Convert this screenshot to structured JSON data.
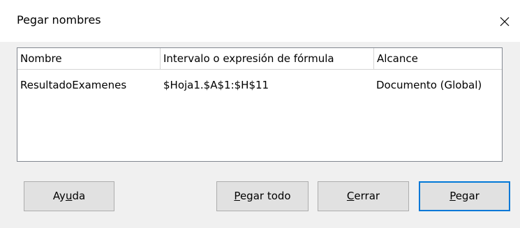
{
  "window": {
    "title": "Pegar nombres",
    "close_glyph": "close-icon"
  },
  "table": {
    "columns": [
      "Nombre",
      "Intervalo o expresión de fórmula",
      "Alcance"
    ],
    "rows": [
      {
        "name": "ResultadoExamenes",
        "range": "$Hoja1.$A$1:$H$11",
        "scope": "Documento (Global)"
      }
    ]
  },
  "buttons": {
    "help": {
      "label_pre": "Ay",
      "label_mnemonic": "u",
      "label_post": "da"
    },
    "paste_all": {
      "label_pre": "",
      "label_mnemonic": "P",
      "label_post": "egar todo"
    },
    "close": {
      "label_pre": "",
      "label_mnemonic": "C",
      "label_post": "errar"
    },
    "paste": {
      "label_pre": "",
      "label_mnemonic": "P",
      "label_post": "egar"
    }
  },
  "colors": {
    "default_button_border": "#0078d7",
    "dialog_bg": "#f0f0f0"
  }
}
